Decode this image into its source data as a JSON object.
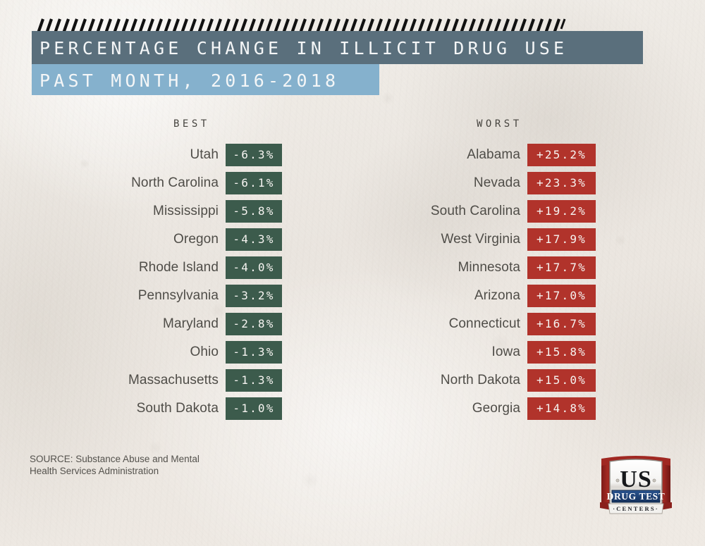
{
  "header": {
    "line1": "PERCENTAGE CHANGE IN ILLICIT DRUG USE",
    "line2": "PAST MONTH, 2016-2018",
    "dark_bar_color": "#5a6f7c",
    "light_bar_color": "#85b1cd",
    "decoration": "zigzag-stitch-icon"
  },
  "columns": {
    "best": {
      "heading": "BEST"
    },
    "worst": {
      "heading": "WORST"
    }
  },
  "chart_data": {
    "type": "table",
    "title": "PERCENTAGE CHANGE IN ILLICIT DRUG USE PAST MONTH, 2016-2018",
    "xlabel": "",
    "ylabel": "Percentage change in past-month illicit drug use",
    "unit": "%",
    "source": "SOURCE: Substance Abuse and Mental Health Services Administration",
    "series": [
      {
        "name": "BEST",
        "color": "#3c5b4c",
        "categories": [
          "Utah",
          "North Carolina",
          "Mississippi",
          "Oregon",
          "Rhode Island",
          "Pennsylvania",
          "Maryland",
          "Ohio",
          "Massachusetts",
          "South Dakota"
        ],
        "values": [
          -6.3,
          -6.1,
          -5.8,
          -4.3,
          -4.0,
          -3.2,
          -2.8,
          -1.3,
          -1.3,
          -1.0
        ],
        "labels": [
          "-6.3%",
          "-6.1%",
          "-5.8%",
          "-4.3%",
          "-4.0%",
          "-3.2%",
          "-2.8%",
          "-1.3%",
          "-1.3%",
          "-1.0%"
        ]
      },
      {
        "name": "WORST",
        "color": "#b1332b",
        "categories": [
          "Alabama",
          "Nevada",
          "South Carolina",
          "West Virginia",
          "Minnesota",
          "Arizona",
          "Connecticut",
          "Iowa",
          "North Dakota",
          "Georgia"
        ],
        "values": [
          25.2,
          23.3,
          19.2,
          17.9,
          17.7,
          17.0,
          16.7,
          15.8,
          15.0,
          14.8
        ],
        "labels": [
          "+25.2%",
          "+23.3%",
          "+19.2%",
          "+17.9%",
          "+17.7%",
          "+17.0%",
          "+16.7%",
          "+15.8%",
          "+15.0%",
          "+14.8%"
        ]
      }
    ]
  },
  "best_rows": [
    {
      "state": "Utah",
      "value": "-6.3%"
    },
    {
      "state": "North Carolina",
      "value": "-6.1%"
    },
    {
      "state": "Mississippi",
      "value": "-5.8%"
    },
    {
      "state": "Oregon",
      "value": "-4.3%"
    },
    {
      "state": "Rhode Island",
      "value": "-4.0%"
    },
    {
      "state": "Pennsylvania",
      "value": "-3.2%"
    },
    {
      "state": "Maryland",
      "value": "-2.8%"
    },
    {
      "state": "Ohio",
      "value": "-1.3%"
    },
    {
      "state": "Massachusetts",
      "value": "-1.3%"
    },
    {
      "state": "South Dakota",
      "value": "-1.0%"
    }
  ],
  "worst_rows": [
    {
      "state": "Alabama",
      "value": "+25.2%"
    },
    {
      "state": "Nevada",
      "value": "+23.3%"
    },
    {
      "state": "South Carolina",
      "value": "+19.2%"
    },
    {
      "state": "West Virginia",
      "value": "+17.9%"
    },
    {
      "state": "Minnesota",
      "value": "+17.7%"
    },
    {
      "state": "Arizona",
      "value": "+17.0%"
    },
    {
      "state": "Connecticut",
      "value": "+16.7%"
    },
    {
      "state": "Iowa",
      "value": "+15.8%"
    },
    {
      "state": "North Dakota",
      "value": "+15.0%"
    },
    {
      "state": "Georgia",
      "value": "+14.8%"
    }
  ],
  "footer": {
    "source_line1": "SOURCE: Substance Abuse and Mental",
    "source_line2": "Health Services Administration"
  },
  "logo": {
    "top_text": "US",
    "middle_text": "DRUG TEST",
    "bottom_text": "· C E N T E R S ·",
    "red": "#9b2520",
    "blue": "#1b3e73"
  }
}
